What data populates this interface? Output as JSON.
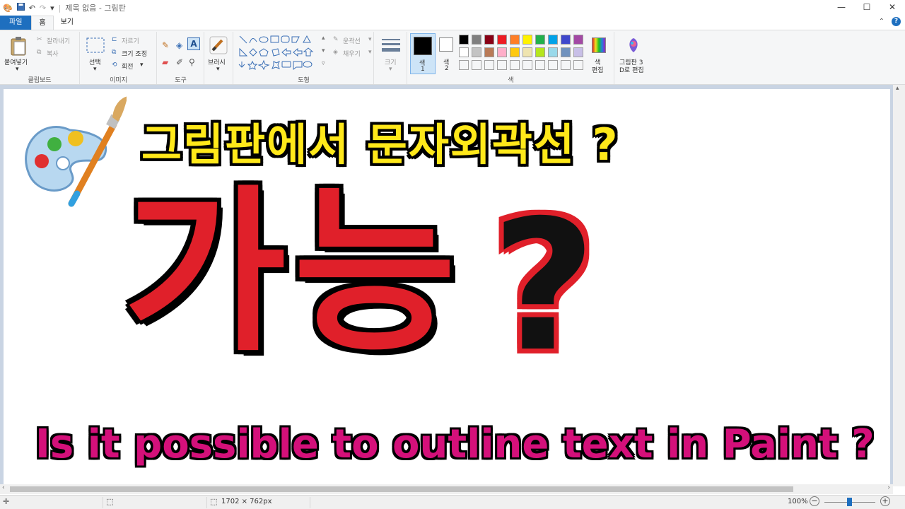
{
  "titlebar": {
    "title": "제목 없음 - 그림판"
  },
  "tabs": {
    "file": "파일",
    "home": "홈",
    "view": "보기"
  },
  "clipboard": {
    "paste": "붙여넣기",
    "cut": "잘라내기",
    "copy": "복사",
    "label": "클립보드"
  },
  "image": {
    "select": "선택",
    "crop": "자르기",
    "resize": "크기 조정",
    "rotate": "회전",
    "label": "이미지"
  },
  "tools": {
    "label": "도구"
  },
  "brushes": {
    "label": "브러시"
  },
  "shapes": {
    "outline": "윤곽선",
    "fill": "채우기",
    "label": "도형"
  },
  "size": {
    "label": "크기"
  },
  "colors": {
    "color1": "색\n1",
    "color1_a": "색",
    "color1_b": "1",
    "color2_a": "색",
    "color2_b": "2",
    "edit_a": "색",
    "edit_b": "편집",
    "paint3d_a": "그림판 3",
    "paint3d_b": "D로 편집",
    "label": "색",
    "row1": [
      "#000000",
      "#7f7f7f",
      "#880015",
      "#ed1c24",
      "#ff7f27",
      "#fff200",
      "#22b14c",
      "#00a2e8",
      "#3f48cc",
      "#a349a4"
    ],
    "row2": [
      "#ffffff",
      "#c3c3c3",
      "#b97a57",
      "#ffaec9",
      "#ffc90e",
      "#efe4b0",
      "#b5e61d",
      "#99d9ea",
      "#7092be",
      "#c8bfe7"
    ],
    "primary": "#000000",
    "secondary": "#ffffff"
  },
  "canvas": {
    "headline": "그림판에서 문자외곽선 ?",
    "possible": "가능",
    "question": "?",
    "english": "Is it possible to outline text in Paint ?"
  },
  "status": {
    "dimensions": "1702 × 762px",
    "zoom": "100%"
  }
}
